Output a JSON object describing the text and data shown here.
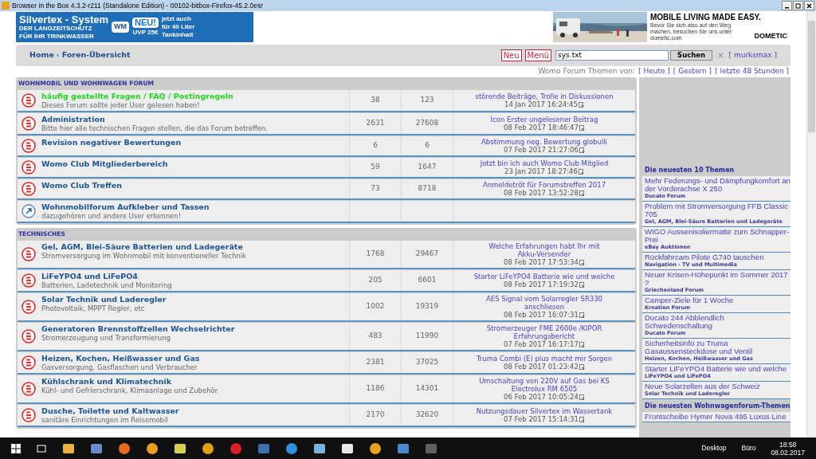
{
  "window": {
    "title": "Browser in the Box 4.3.2-r211 (Standalone Edition) - 00102-bitbox-Firefox-45.2.0esr"
  },
  "banner_left": {
    "title": "Silvertex - System",
    "lines": [
      "DER LANGZEITSCHUTZ",
      "FÜR IHR TRINKWASSER"
    ],
    "logo": "WM",
    "badge": "NEU!",
    "price": "UVP 25€",
    "offer": [
      "jetzt auch",
      "für 40 Liter",
      "Tankinhalt"
    ]
  },
  "banner_right": {
    "headline": "MOBILE LIVING MADE EASY.",
    "text": "Bevor Sie sich also auf den Weg machen, besuchen Sie uns unter dometic.com",
    "brand": "DOMETIC"
  },
  "nav": {
    "breadcrumb": [
      "Home",
      "Foren-Übersicht"
    ],
    "separator": "‹",
    "buttons": [
      "Neu",
      "Menü"
    ],
    "search": {
      "value": "sys.txt",
      "button": "Suchen",
      "clear": "×"
    },
    "user": "[ murksmax ]"
  },
  "themen_von": {
    "label": "Womo Forum Themen von:",
    "links": [
      "[ Heute ]",
      "[ Gestern ]",
      "[ letzte 48 Stunden ]"
    ]
  },
  "sections": [
    {
      "title": "WOHNMOBIL UND WOHNWAGEN FORUM",
      "forums": [
        {
          "kind": "forum",
          "highlighted": true,
          "title": "häufig gestellte Fragen / FAQ / Postingregeln",
          "description": "Dieses Forum sollte jeder User gelesen haben!",
          "topics": "38",
          "posts": "123",
          "last_post": [
            "störende Beiträge, Trolle in Diskussionen"
          ],
          "date": "14 Jan 2017 16:24:45"
        },
        {
          "kind": "forum",
          "highlighted": false,
          "title": "Administration",
          "description": "Bitte hier alle technischen Fragen stellen, die das Forum betreffen.",
          "topics": "2631",
          "posts": "27608",
          "last_post": [
            "Icon Erster ungelesener Beitrag"
          ],
          "date": "08 Feb 2017 18:46:47"
        },
        {
          "kind": "forum",
          "highlighted": false,
          "title": "Revision negativer Bewertungen",
          "topics": "6",
          "posts": "6",
          "last_post": [
            "Abstimmung neg. Bewertung globulli"
          ],
          "date": "07 Feb 2017 21:27:06"
        },
        {
          "kind": "forum",
          "highlighted": false,
          "title": "Womo Club Mitgliederbereich",
          "topics": "59",
          "posts": "1647",
          "last_post": [
            "Jetzt bin ich auch Womo Club Mitglied"
          ],
          "date": "23 Jan 2017 18:27:46"
        },
        {
          "kind": "forum",
          "highlighted": false,
          "title": "Womo Club Treffen",
          "topics": "73",
          "posts": "8718",
          "last_post": [
            "Anmeldetröt für Forumstreffen 2017"
          ],
          "date": "08 Feb 2017 13:52:28"
        },
        {
          "kind": "link",
          "highlighted": false,
          "title": "Wohnmobilforum Aufkleber und Tassen",
          "description": "dazugehören und andere User erkennen!"
        }
      ]
    },
    {
      "title": "TECHNISCHES",
      "forums": [
        {
          "kind": "forum",
          "highlighted": false,
          "title": "Gel, AGM, Blei-Säure Batterien und Ladegeräte",
          "description": "Stromversorgung im Wohnmobil mit konventioneller Technik",
          "topics": "1768",
          "posts": "29467",
          "last_post": [
            "Welche Erfahrungen habt Ihr mit",
            "Akku-Versender"
          ],
          "date": "08 Feb 2017 17:53:34"
        },
        {
          "kind": "forum",
          "highlighted": false,
          "title": "LiFeYPO4 und LiFePO4",
          "description": "Batterien, Ladetechnik und Monitoring",
          "topics": "205",
          "posts": "6601",
          "last_post": [
            "Starter LiFeYPO4 Batterie wie und welche"
          ],
          "date": "08 Feb 2017 17:19:32"
        },
        {
          "kind": "forum",
          "highlighted": false,
          "title": "Solar Technik und Laderegler",
          "description": "Photovoltaik, MPPT Regler, etc",
          "topics": "1002",
          "posts": "19319",
          "last_post": [
            "AES Signal vom Solarregler SR330",
            "anschliesen"
          ],
          "date": "08 Feb 2017 16:07:31"
        },
        {
          "kind": "forum",
          "highlighted": false,
          "title": "Generatoren Brennstoffzellen Wechselrichter",
          "description": "Stromerzeugung und Transformierung",
          "topics": "483",
          "posts": "11990",
          "last_post": [
            "Stromerzeuger FME 2600e /KIPOR",
            "Erfahrungsbericht"
          ],
          "date": "07 Feb 2017 16:17:17"
        },
        {
          "kind": "forum",
          "highlighted": false,
          "title": "Heizen, Kochen, Heißwasser und Gas",
          "description": "Gasversorgung, Gasflaschen und Verbraucher",
          "topics": "2381",
          "posts": "37025",
          "last_post": [
            "Truma Combi (E) plus macht mir Sorgen"
          ],
          "date": "08 Feb 2017 01:23:42"
        },
        {
          "kind": "forum",
          "highlighted": false,
          "title": "Kühlschrank und Klimatechnik",
          "description": "Kühl- und Gefrierschrank, Klimaanlage und Zubehör",
          "topics": "1186",
          "posts": "14301",
          "last_post": [
            "Umschaltung von 220V auf Gas bei KS",
            "Electrolux RM 6505"
          ],
          "date": "06 Feb 2017 10:05:24"
        },
        {
          "kind": "forum",
          "highlighted": false,
          "title": "Dusche, Toilette und Kaltwasser",
          "description": "sanitäre Einrichtungen im Reisemobil",
          "topics": "2170",
          "posts": "32620",
          "last_post": [
            "Nutzungsdauer Silvertex im Wassertank"
          ],
          "date": "07 Feb 2017 15:14:31"
        }
      ]
    }
  ],
  "sidebar": [
    {
      "title": "Die neuesten 10 Themen",
      "items": [
        {
          "title": "Mehr Federungs- und Dämpfungkomfort an der Vorderachse X 250",
          "forum": "Ducato Forum"
        },
        {
          "title": "Problem mit Stromversorgung FFB Classic 705",
          "forum": "Gel, AGM, Blei-Säure Batterien und Ladegeräte"
        },
        {
          "title": "WIGO Aussenisoliermatte zum Schnapper-Prei",
          "forum": "eBay Auktionen"
        },
        {
          "title": "Rückfahrcam Pilote G740 tauschen",
          "forum": "Navigation - TV und Multimedia"
        },
        {
          "title": "Neuer Krisen-Höhepunkt im Sommer 2017 ?",
          "forum": "Griechenland Forum"
        },
        {
          "title": "Camper-Ziele für 1 Woche",
          "forum": "Kroatien Forum"
        },
        {
          "title": "Ducato 244 Abblendlich Schwedenschaltung",
          "forum": "Ducato Forum"
        },
        {
          "title": "Sicherheitsinfo zu Truma Gasaussensteckdose und Ventil",
          "forum": "Heizen, Kochen, Heißwasser und Gas"
        },
        {
          "title": "Starter LiFeYPO4 Batterie wie und welche",
          "forum": "LiFeYPO4 und LiFePO4"
        },
        {
          "title": "Neue Solarzellen aus der Schweiz",
          "forum": "Solar Technik und Laderegler"
        }
      ]
    },
    {
      "title": "Die neuesten Wohnwagenforum-Themen",
      "items": [
        {
          "title": "Frontscheibe Hymer Nova 495 Luxus Line"
        }
      ]
    }
  ],
  "taskbar": {
    "labels": [
      "Desktop",
      "Büro"
    ],
    "time": "18:58",
    "date": "08.02.2017"
  }
}
